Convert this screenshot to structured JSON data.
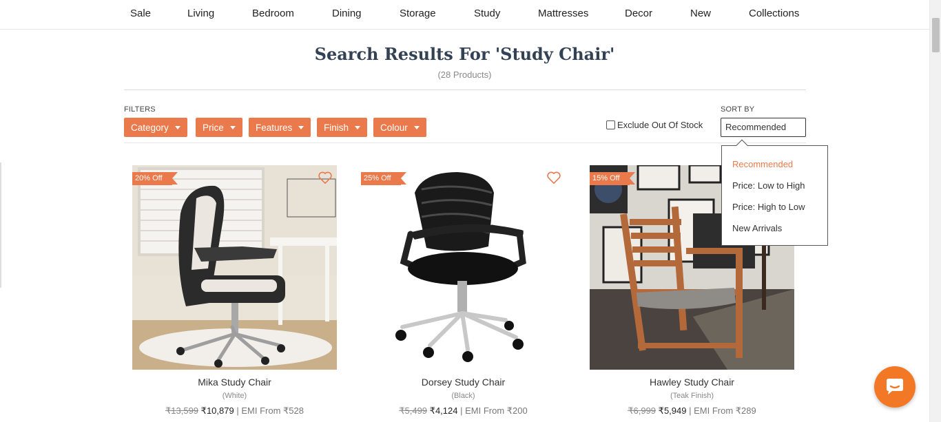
{
  "nav": {
    "items": [
      "Sale",
      "Living",
      "Bedroom",
      "Dining",
      "Storage",
      "Study",
      "Mattresses",
      "Decor",
      "New",
      "Collections"
    ]
  },
  "search": {
    "title": "Search Results For 'Study Chair'",
    "count": "(28 Products)"
  },
  "filters": {
    "label": "FILTERS",
    "buttons": [
      "Category",
      "Price",
      "Features",
      "Finish",
      "Colour"
    ]
  },
  "exclude": {
    "label": "Exclude Out Of Stock",
    "checked": false
  },
  "sort": {
    "label": "SORT BY",
    "selected": "Recommended",
    "options": [
      "Recommended",
      "Price: Low to High",
      "Price: High to Low",
      "New Arrivals"
    ]
  },
  "products": [
    {
      "badge": "20% Off",
      "name": "Mika Study Chair",
      "variant": "(White)",
      "mrp": "₹13,599",
      "price": "₹10,879",
      "emi": "EMI From ₹528"
    },
    {
      "badge": "25% Off",
      "name": "Dorsey Study Chair",
      "variant": "(Black)",
      "mrp": "₹5,499",
      "price": "₹4,124",
      "emi": "EMI From ₹200"
    },
    {
      "badge": "15% Off",
      "name": "Hawley Study Chair",
      "variant": "(Teak Finish)",
      "mrp": "₹6,999",
      "price": "₹5,949",
      "emi": "EMI From ₹289"
    }
  ],
  "colors": {
    "accent": "#ea7a4b",
    "chat": "#f27826"
  },
  "icons": [
    "heart-icon",
    "chevron-down-icon",
    "chat-icon"
  ]
}
